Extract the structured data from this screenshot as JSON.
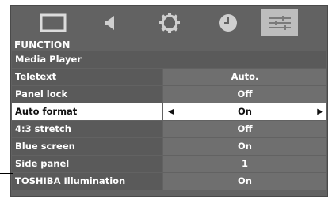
{
  "tabs": [
    {
      "icon": "picture-icon",
      "active": false
    },
    {
      "icon": "speaker-icon",
      "active": false
    },
    {
      "icon": "gear-icon",
      "active": false
    },
    {
      "icon": "clock-icon",
      "active": false
    },
    {
      "icon": "sliders-icon",
      "active": true
    }
  ],
  "section_title": "FUNCTION",
  "rows": [
    {
      "label": "Media Player",
      "value": ""
    },
    {
      "label": "Teletext",
      "value": "Auto."
    },
    {
      "label": "Panel lock",
      "value": "Off"
    },
    {
      "label": "Auto format",
      "value": "On",
      "selected": true
    },
    {
      "label": "4:3 stretch",
      "value": "Off"
    },
    {
      "label": "Blue screen",
      "value": "On"
    },
    {
      "label": "Side panel",
      "value": "1"
    },
    {
      "label": "TOSHIBA Illumination",
      "value": "On"
    }
  ],
  "arrows": {
    "left": "◀",
    "right": "▶"
  },
  "colors": {
    "background": "#626262",
    "active_tab": "#bdbdbd",
    "selected_row": "#ffffff"
  }
}
